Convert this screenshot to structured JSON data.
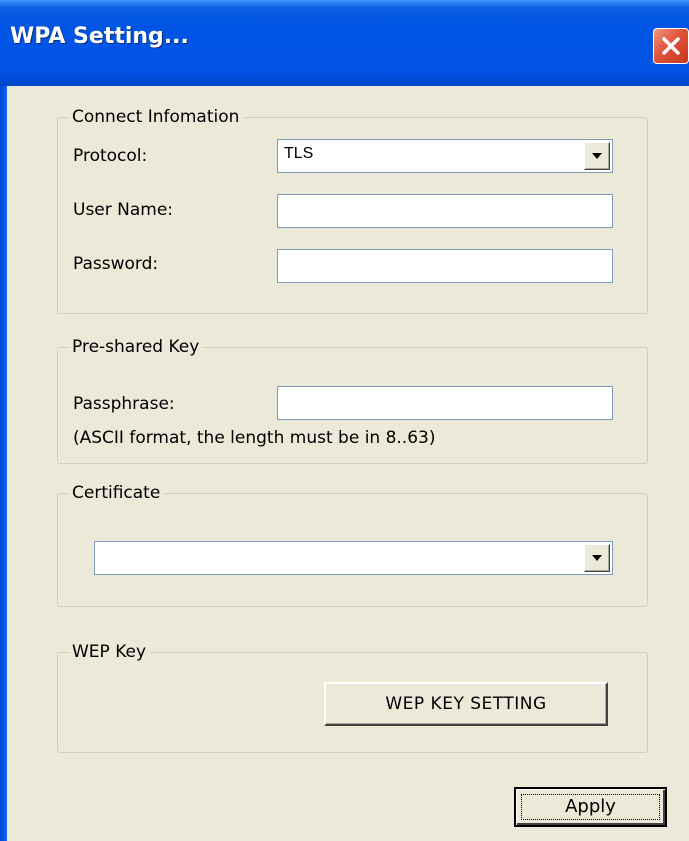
{
  "window": {
    "title": "WPA Setting..."
  },
  "connect_group": {
    "legend": "Connect Infomation",
    "protocol_label": "Protocol:",
    "protocol_value": "TLS",
    "username_label": "User Name:",
    "username_value": "",
    "password_label": "Password:",
    "password_value": ""
  },
  "psk_group": {
    "legend": "Pre-shared Key",
    "passphrase_label": "Passphrase:",
    "passphrase_value": "",
    "hint": "(ASCII format, the length must be in 8..63)"
  },
  "cert_group": {
    "legend": "Certificate",
    "certificate_value": ""
  },
  "wep_group": {
    "legend": "WEP Key",
    "button_label": "WEP KEY SETTING"
  },
  "footer": {
    "apply_label": "Apply"
  },
  "colors": {
    "titlebar": "#0055e5",
    "dialog_bg": "#ece9d8",
    "close_button": "#e1523a"
  }
}
